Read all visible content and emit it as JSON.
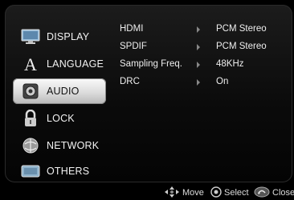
{
  "sidebar": {
    "items": [
      {
        "label": "DISPLAY",
        "icon": "display-icon",
        "active": false
      },
      {
        "label": "LANGUAGE",
        "icon": "language-icon",
        "active": false
      },
      {
        "label": "AUDIO",
        "icon": "audio-icon",
        "active": true
      },
      {
        "label": "LOCK",
        "icon": "lock-icon",
        "active": false
      },
      {
        "label": "NETWORK",
        "icon": "network-icon",
        "active": false
      },
      {
        "label": "OTHERS",
        "icon": "others-icon",
        "active": false
      }
    ]
  },
  "settings": [
    {
      "name": "HDMI",
      "value": "PCM Stereo"
    },
    {
      "name": "SPDIF",
      "value": "PCM Stereo"
    },
    {
      "name": "Sampling Freq.",
      "value": "48KHz"
    },
    {
      "name": "DRC",
      "value": "On"
    }
  ],
  "hints": {
    "move": "Move",
    "select": "Select",
    "close": "Close"
  },
  "colors": {
    "highlight": "#e6e6e6",
    "background": "#0b0b0b",
    "text": "#f2f2f2"
  }
}
